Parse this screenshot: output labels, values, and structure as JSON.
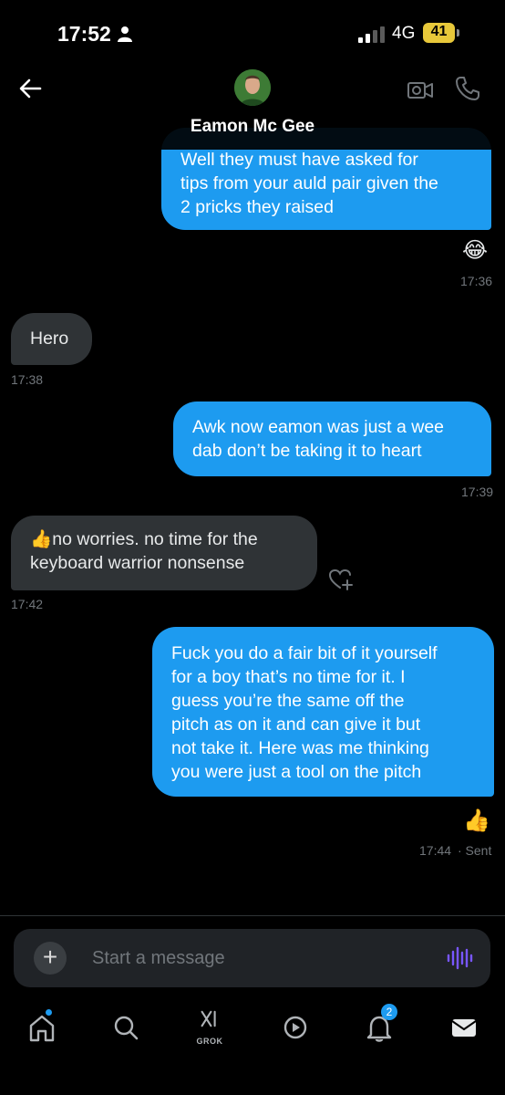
{
  "status_bar": {
    "time": "17:52",
    "network": "4G",
    "battery": "41",
    "battery_color": "#e8c83a"
  },
  "header": {
    "contact_name": "Eamon Mc Gee",
    "icons": [
      "back-arrow-icon",
      "video-call-icon",
      "phone-icon"
    ]
  },
  "messages": [
    {
      "direction": "outgoing",
      "text_lines": [
        "Well they must have asked for",
        "tips from your auld pair given the",
        "2 pricks they raised"
      ],
      "reaction": "😂",
      "time": "17:36"
    },
    {
      "direction": "incoming",
      "text_lines": [
        "Hero"
      ],
      "time": "17:38"
    },
    {
      "direction": "outgoing",
      "text_lines": [
        "Awk now eamon was just a wee",
        "dab don’t be taking it to heart"
      ],
      "time": "17:39"
    },
    {
      "direction": "incoming",
      "text_lines": [
        "👍no worries.  no time for the",
        "keyboard warrior nonsense"
      ],
      "time": "17:42"
    },
    {
      "direction": "outgoing",
      "text_lines": [
        "Fuck you do a fair bit of it yourself",
        "for a boy that’s no time for it. I",
        "guess you’re the same off the",
        "pitch as on it and can give it but",
        "not take it. Here was me thinking",
        "you were just a tool on the pitch"
      ],
      "reaction": "👍",
      "time": "17:44",
      "status": "· Sent"
    }
  ],
  "composer": {
    "placeholder": "Start a message",
    "add_label": "+"
  },
  "nav": {
    "items": [
      "home-icon",
      "search-icon",
      "grok-icon",
      "video-icon",
      "notifications-icon",
      "messages-icon"
    ],
    "grok_label": "GROK",
    "notifications_count": "2"
  },
  "colors": {
    "accent": "#1d9bf0",
    "incoming_bubble": "#2f3336",
    "background": "#000000"
  }
}
